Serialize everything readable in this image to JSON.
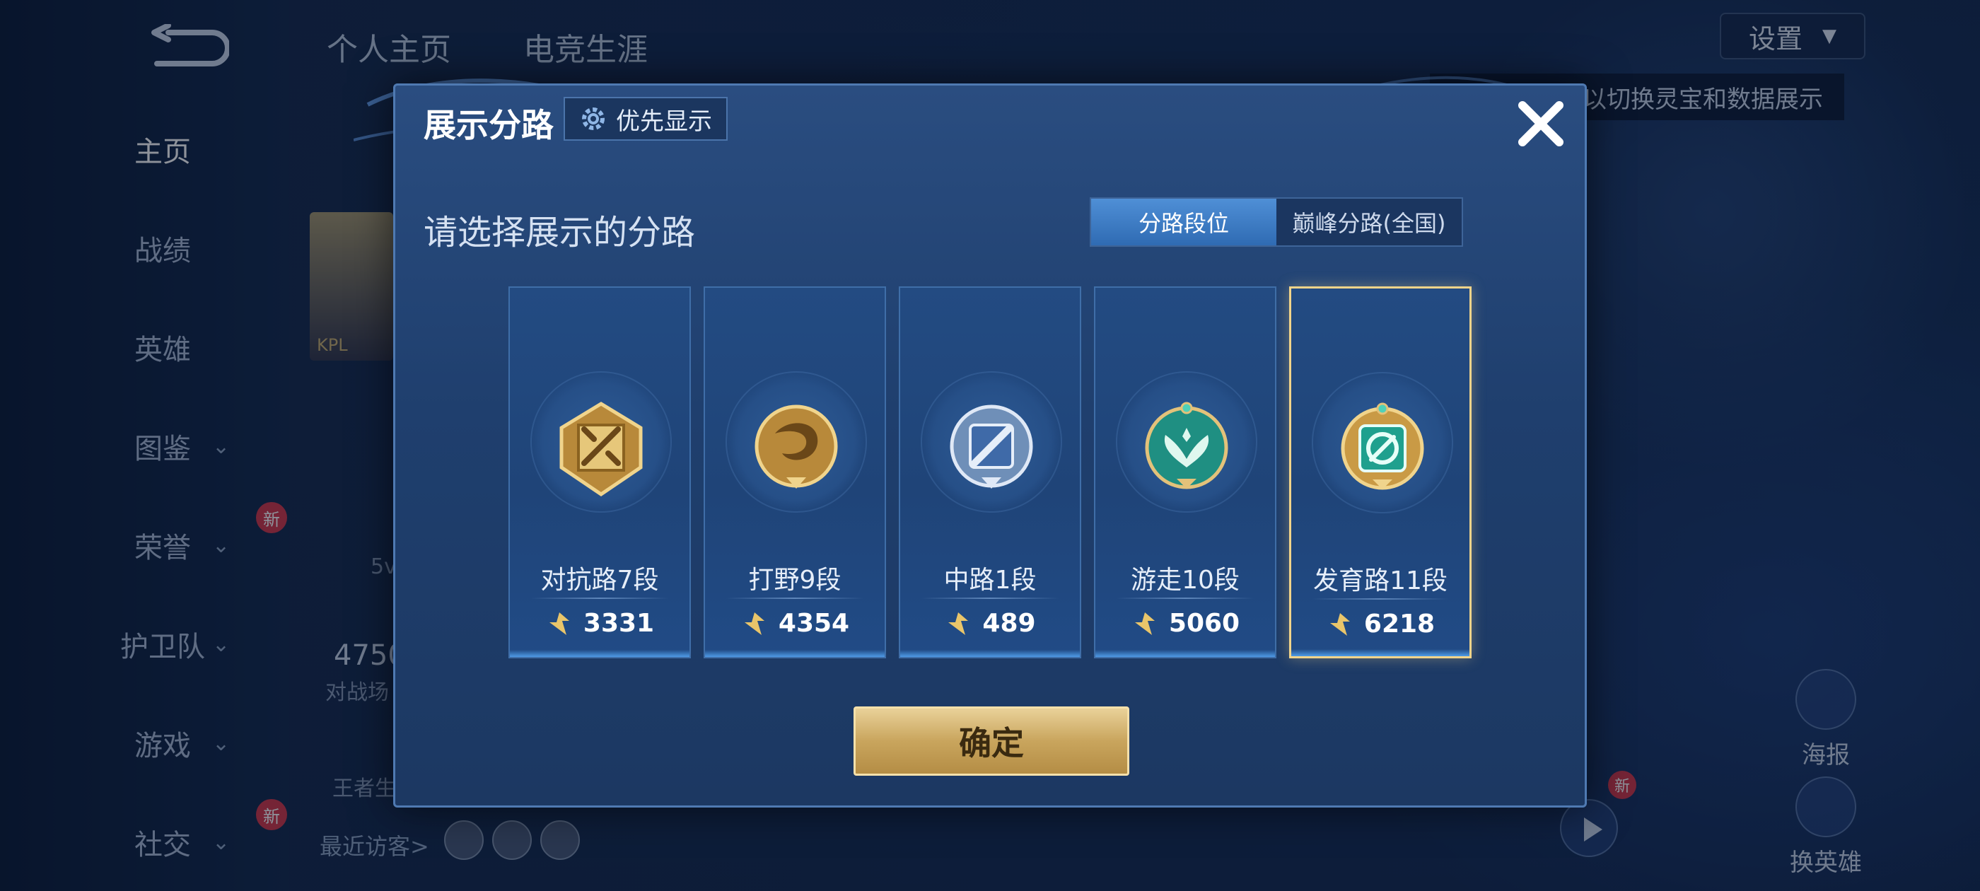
{
  "sidebar": {
    "items": [
      {
        "label": "主页",
        "active": true,
        "has_chevron": false
      },
      {
        "label": "战绩",
        "has_chevron": false
      },
      {
        "label": "英雄",
        "has_chevron": false
      },
      {
        "label": "图鉴",
        "has_chevron": true
      },
      {
        "label": "荣誉",
        "has_chevron": true,
        "badge": "新"
      },
      {
        "label": "护卫队",
        "has_chevron": true
      },
      {
        "label": "游戏",
        "has_chevron": true
      },
      {
        "label": "社交",
        "has_chevron": true,
        "badge": "新"
      }
    ]
  },
  "top_tabs": [
    "个人主页",
    "电竞生涯"
  ],
  "settings": {
    "label": "设置"
  },
  "hint_text": "以切换灵宝和数据展示",
  "background": {
    "stat_value": "4750",
    "stat_label": "对战场",
    "king_label": "王者生",
    "kpl_tag": "KPL",
    "level_text": "5v",
    "recent_visitors": "最近访客>",
    "poster_label": "海报",
    "switch_hero_label": "换英雄",
    "new_badge": "新"
  },
  "dialog": {
    "title": "展示分路",
    "priority_button": "优先显示",
    "subtitle": "请选择展示的分路",
    "toggle": [
      "分路段位",
      "巅峰分路(全国)"
    ],
    "toggle_selected": 0,
    "lanes": [
      {
        "name": "对抗路7段",
        "score": "3331",
        "icon": "clash-lane-emblem-icon",
        "selected": false
      },
      {
        "name": "打野9段",
        "score": "4354",
        "icon": "jungle-dragon-emblem-icon",
        "selected": false
      },
      {
        "name": "中路1段",
        "score": "489",
        "icon": "mid-lane-emblem-icon",
        "selected": false
      },
      {
        "name": "游走10段",
        "score": "5060",
        "icon": "roam-wings-emblem-icon",
        "selected": false
      },
      {
        "name": "发育路11段",
        "score": "6218",
        "icon": "farm-lane-emblem-icon",
        "selected": true
      }
    ],
    "confirm_button": "确定"
  },
  "colors": {
    "accent_gold": "#f2d48a",
    "toggle_active": "#3f7fc6",
    "panel": "#234b82"
  }
}
